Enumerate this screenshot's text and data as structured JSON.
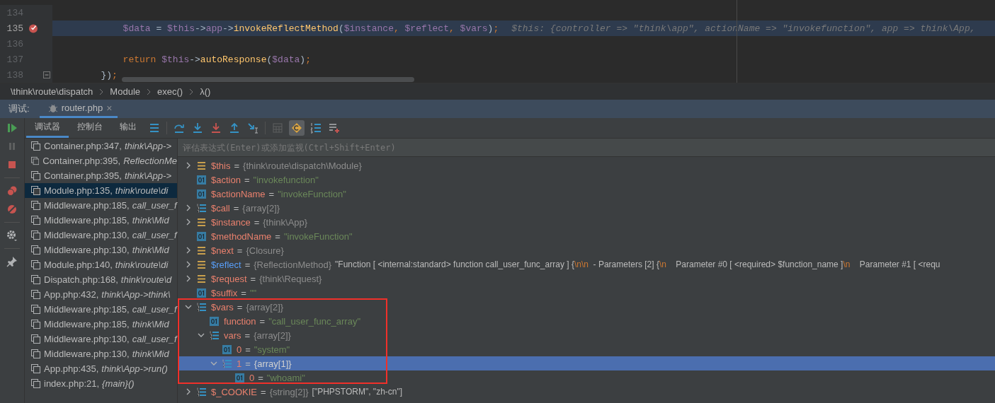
{
  "editor": {
    "lines": [
      {
        "number": "134",
        "breakpoint": false,
        "current": false,
        "fold": false
      },
      {
        "number": "135",
        "breakpoint": true,
        "current": true,
        "fold": false,
        "tokens": [
          {
            "kind": "var",
            "text": "            $data"
          },
          {
            "kind": "plain",
            "text": " = "
          },
          {
            "kind": "var",
            "text": "$this"
          },
          {
            "kind": "plain",
            "text": "->"
          },
          {
            "kind": "var",
            "text": "app"
          },
          {
            "kind": "plain",
            "text": "->"
          },
          {
            "kind": "method",
            "text": "invokeReflectMethod"
          },
          {
            "kind": "plain",
            "text": "("
          },
          {
            "kind": "var",
            "text": "$instance"
          },
          {
            "kind": "punct",
            "text": ", "
          },
          {
            "kind": "var",
            "text": "$reflect"
          },
          {
            "kind": "punct",
            "text": ", "
          },
          {
            "kind": "var",
            "text": "$vars"
          },
          {
            "kind": "plain",
            "text": ")"
          },
          {
            "kind": "punct",
            "text": ";"
          }
        ],
        "hint": "$this: {controller => \"think\\app\", actionName => \"invokefunction\", app => think\\App,"
      },
      {
        "number": "136",
        "breakpoint": false,
        "current": false,
        "fold": false
      },
      {
        "number": "137",
        "breakpoint": false,
        "current": false,
        "fold": false,
        "tokens": [
          {
            "kind": "kw",
            "text": "            return "
          },
          {
            "kind": "var",
            "text": "$this"
          },
          {
            "kind": "plain",
            "text": "->"
          },
          {
            "kind": "method",
            "text": "autoResponse"
          },
          {
            "kind": "plain",
            "text": "("
          },
          {
            "kind": "var",
            "text": "$data"
          },
          {
            "kind": "plain",
            "text": ")"
          },
          {
            "kind": "punct",
            "text": ";"
          }
        ]
      },
      {
        "number": "138",
        "breakpoint": false,
        "current": false,
        "fold": true,
        "tokens": [
          {
            "kind": "plain",
            "text": "        })"
          },
          {
            "kind": "punct",
            "text": ";"
          }
        ]
      }
    ]
  },
  "breadcrumbs": [
    "\\think\\route\\dispatch",
    "Module",
    "exec()",
    "λ()"
  ],
  "debug_header": {
    "label": "调试:",
    "tabs": [
      {
        "label": "router.php",
        "close": "×",
        "selected": true
      }
    ]
  },
  "toolbar": {
    "tabs": [
      {
        "label": "调试器",
        "selected": true
      },
      {
        "label": "控制台",
        "selected": false
      },
      {
        "label": "输出",
        "selected": false
      }
    ],
    "library_frames_on": true
  },
  "frames": [
    {
      "file": "Container.php:347,",
      "method": "think\\App->",
      "selected": false
    },
    {
      "file": "Container.php:395,",
      "method": "ReflectionMe",
      "selected": false
    },
    {
      "file": "Container.php:395,",
      "method": "think\\App->",
      "selected": false
    },
    {
      "file": "Module.php:135,",
      "method": "think\\route\\di",
      "selected": true
    },
    {
      "file": "Middleware.php:185,",
      "method": "call_user_f",
      "selected": false
    },
    {
      "file": "Middleware.php:185,",
      "method": "think\\Mid",
      "selected": false
    },
    {
      "file": "Middleware.php:130,",
      "method": "call_user_f",
      "selected": false
    },
    {
      "file": "Middleware.php:130,",
      "method": "think\\Mid",
      "selected": false
    },
    {
      "file": "Module.php:140,",
      "method": "think\\route\\di",
      "selected": false
    },
    {
      "file": "Dispatch.php:168,",
      "method": "think\\route\\d",
      "selected": false
    },
    {
      "file": "App.php:432,",
      "method": "think\\App->think\\",
      "selected": false
    },
    {
      "file": "Middleware.php:185,",
      "method": "call_user_f",
      "selected": false
    },
    {
      "file": "Middleware.php:185,",
      "method": "think\\Mid",
      "selected": false
    },
    {
      "file": "Middleware.php:130,",
      "method": "call_user_f",
      "selected": false
    },
    {
      "file": "Middleware.php:130,",
      "method": "think\\Mid",
      "selected": false
    },
    {
      "file": "App.php:435,",
      "method": "think\\App->run()",
      "selected": false
    },
    {
      "file": "index.php:21,",
      "method": "{main}()",
      "selected": false
    }
  ],
  "variables": {
    "placeholder": "评估表达式(Enter)或添加监视(Ctrl+Shift+Enter)",
    "items": [
      {
        "name": "$this",
        "eq": "=",
        "kind": "object",
        "type": "{think\\route\\dispatch\\Module}",
        "expanded": false,
        "selected": false,
        "highlighted": false
      },
      {
        "name": "$action",
        "eq": "=",
        "kind": "scalar",
        "value": "\"invokefunction\"",
        "selected": false,
        "highlighted": false
      },
      {
        "name": "$actionName",
        "eq": "=",
        "kind": "scalar",
        "value": "\"invokeFunction\"",
        "selected": false,
        "highlighted": false
      },
      {
        "name": "$call",
        "eq": "=",
        "kind": "array",
        "type": "{array[2]}",
        "expanded": false,
        "selected": false,
        "highlighted": false
      },
      {
        "name": "$instance",
        "eq": "=",
        "kind": "object",
        "type": "{think\\App}",
        "expanded": false,
        "selected": false,
        "highlighted": false
      },
      {
        "name": "$methodName",
        "eq": "=",
        "kind": "scalar",
        "value": "\"invokeFunction\"",
        "selected": false,
        "highlighted": false
      },
      {
        "name": "$next",
        "eq": "=",
        "kind": "object",
        "type": "{Closure}",
        "expanded": false,
        "selected": false,
        "highlighted": false
      },
      {
        "name": "$reflect",
        "eq": "=",
        "kind": "object",
        "type": "{ReflectionMethod}",
        "expanded": false,
        "selected": false,
        "highlighted": true,
        "details": [
          {
            "kind": "text",
            "text": "\"Function [ <internal:standard> function call_user_func_array ] {"
          },
          {
            "kind": "escape",
            "text": "\\n\\n"
          },
          {
            "kind": "text",
            "text": "  - Parameters [2] {"
          },
          {
            "kind": "escape",
            "text": "\\n"
          },
          {
            "kind": "text",
            "text": "    Parameter #0 [ <required> $function_name ]"
          },
          {
            "kind": "escape",
            "text": "\\n"
          },
          {
            "kind": "text",
            "text": "    Parameter #1 [ <requ"
          }
        ]
      },
      {
        "name": "$request",
        "eq": "=",
        "kind": "object",
        "type": "{think\\Request}",
        "expanded": false,
        "selected": false,
        "highlighted": false
      },
      {
        "name": "$suffix",
        "eq": "=",
        "kind": "scalar",
        "value": "\"\"",
        "selected": false,
        "highlighted": false
      },
      {
        "name": "$vars",
        "eq": "=",
        "kind": "array",
        "type": "{array[2]}",
        "expanded": true,
        "selected": false,
        "highlighted": false,
        "children": [
          {
            "name": "function",
            "eq": "=",
            "kind": "scalar",
            "value": "\"call_user_func_array\"",
            "selected": false
          },
          {
            "name": "vars",
            "eq": "=",
            "kind": "array",
            "type": "{array[2]}",
            "expanded": true,
            "selected": false,
            "children": [
              {
                "name": "0",
                "eq": "=",
                "kind": "scalar",
                "value": "\"system\"",
                "selected": false
              },
              {
                "name": "1",
                "eq": "=",
                "kind": "array",
                "type": "{array[1]}",
                "expanded": true,
                "selected": true,
                "children": [
                  {
                    "name": "0",
                    "eq": "=",
                    "kind": "scalar",
                    "value": "\"whoami\"",
                    "selected": false
                  }
                ]
              }
            ]
          }
        ]
      },
      {
        "name": "$_COOKIE",
        "eq": "=",
        "kind": "array",
        "type": "{string[2]}",
        "extra": "[\"PHPSTORM\", \"zh-cn\"]",
        "expanded": false,
        "selected": false,
        "highlighted": false
      }
    ]
  }
}
